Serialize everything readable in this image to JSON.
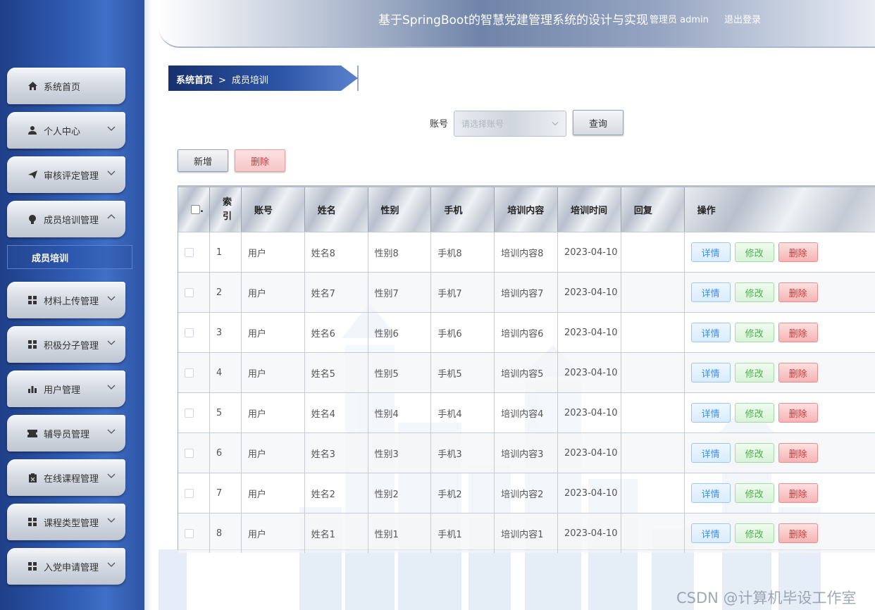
{
  "header": {
    "title": "基于SpringBoot的智慧党建管理系统的设计与实现",
    "user_text": "管理员 admin",
    "logout": "退出登录"
  },
  "sidebar": {
    "items": [
      {
        "label": "系统首页",
        "icon": "home-icon",
        "expandable": false
      },
      {
        "label": "个人中心",
        "icon": "person-icon",
        "expandable": true
      },
      {
        "label": "审核评定管理",
        "icon": "send-icon",
        "expandable": true
      },
      {
        "label": "成员培训管理",
        "icon": "lightbulb-icon",
        "expandable": true,
        "expanded": true
      },
      {
        "label": "材料上传管理",
        "icon": "grid-icon",
        "expandable": true
      },
      {
        "label": "积极分子管理",
        "icon": "grid-icon",
        "expandable": true
      },
      {
        "label": "用户管理",
        "icon": "bar-chart-icon",
        "expandable": true
      },
      {
        "label": "辅导员管理",
        "icon": "ticket-icon",
        "expandable": true
      },
      {
        "label": "在线课程管理",
        "icon": "clipboard-icon",
        "expandable": true
      },
      {
        "label": "课程类型管理",
        "icon": "grid-icon",
        "expandable": true
      },
      {
        "label": "入党申请管理",
        "icon": "grid-icon",
        "expandable": true
      }
    ],
    "submenu": {
      "label": "成员培训"
    }
  },
  "breadcrumb": {
    "home": "系统首页",
    "separator": ">",
    "current": "成员培训"
  },
  "search": {
    "label": "账号",
    "placeholder": "请选择账号",
    "query_button": "查询"
  },
  "toolbar": {
    "add_label": "新增",
    "delete_label": "删除"
  },
  "table": {
    "columns": [
      ".",
      "索引",
      "账号",
      "姓名",
      "性别",
      "手机",
      "培训内容",
      "培训时间",
      "回复",
      "操作"
    ],
    "actions": {
      "detail": "详情",
      "edit": "修改",
      "delete": "删除"
    },
    "rows": [
      {
        "index": "1",
        "account": "用户",
        "name": "姓名8",
        "gender": "性别8",
        "phone": "手机8",
        "content": "培训内容8",
        "time": "2023-04-10",
        "reply": ""
      },
      {
        "index": "2",
        "account": "用户",
        "name": "姓名7",
        "gender": "性别7",
        "phone": "手机7",
        "content": "培训内容7",
        "time": "2023-04-10",
        "reply": ""
      },
      {
        "index": "3",
        "account": "用户",
        "name": "姓名6",
        "gender": "性别6",
        "phone": "手机6",
        "content": "培训内容6",
        "time": "2023-04-10",
        "reply": ""
      },
      {
        "index": "4",
        "account": "用户",
        "name": "姓名5",
        "gender": "性别5",
        "phone": "手机5",
        "content": "培训内容5",
        "time": "2023-04-10",
        "reply": ""
      },
      {
        "index": "5",
        "account": "用户",
        "name": "姓名4",
        "gender": "性别4",
        "phone": "手机4",
        "content": "培训内容4",
        "time": "2023-04-10",
        "reply": ""
      },
      {
        "index": "6",
        "account": "用户",
        "name": "姓名3",
        "gender": "性别3",
        "phone": "手机3",
        "content": "培训内容3",
        "time": "2023-04-10",
        "reply": ""
      },
      {
        "index": "7",
        "account": "用户",
        "name": "姓名2",
        "gender": "性别2",
        "phone": "手机2",
        "content": "培训内容2",
        "time": "2023-04-10",
        "reply": ""
      },
      {
        "index": "8",
        "account": "用户",
        "name": "姓名1",
        "gender": "性别1",
        "phone": "手机1",
        "content": "培训内容1",
        "time": "2023-04-10",
        "reply": ""
      }
    ]
  },
  "watermark": "CSDN @计算机毕设工作室",
  "colors": {
    "sidebar": "#2f5bb2",
    "breadcrumb": "#1f3f88",
    "detail": "#3a8ee6",
    "edit": "#4cb04c",
    "delete": "#dd3333"
  }
}
